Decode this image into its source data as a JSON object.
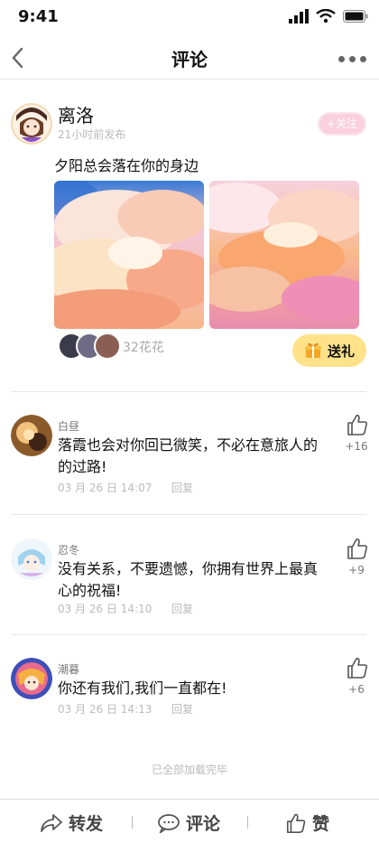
{
  "status": {
    "time": "9:41",
    "icons": [
      "signal-icon",
      "wifi-icon",
      "battery-icon"
    ]
  },
  "nav": {
    "title": "评论",
    "back_icon": "back-chevron-icon",
    "more_icon": "more-dots-icon"
  },
  "post": {
    "author": "离洛",
    "time": "21小时前发布",
    "follow_label": "+关注",
    "text": "夕阳总会落在你的身边",
    "flower_count": "32花花",
    "gift_label": "送礼"
  },
  "comments": [
    {
      "name": "白昼",
      "text": "落霞也会对你回已微笑，不必在意旅人的的过路!",
      "time": "03 月 26 日 14:07",
      "reply": "回复",
      "likes": "+16"
    },
    {
      "name": "忍冬",
      "text": "没有关系，不要遗憾，你拥有世界上最真心的祝福!",
      "time": "03 月 26 日 14:10",
      "reply": "回复",
      "likes": "+9"
    },
    {
      "name": "潮暮",
      "text": "你还有我们,我们一直都在!",
      "time": "03 月 26 日 14:13",
      "reply": "回复",
      "likes": "+6"
    }
  ],
  "footer_note": "已全部加载完毕",
  "bottom_bar": {
    "share": "转发",
    "comment": "评论",
    "like": "赞"
  },
  "colors": {
    "follow_bg": "#fbd0de",
    "gift_bg": "#ffe28a",
    "muted": "#bbbbbb"
  }
}
